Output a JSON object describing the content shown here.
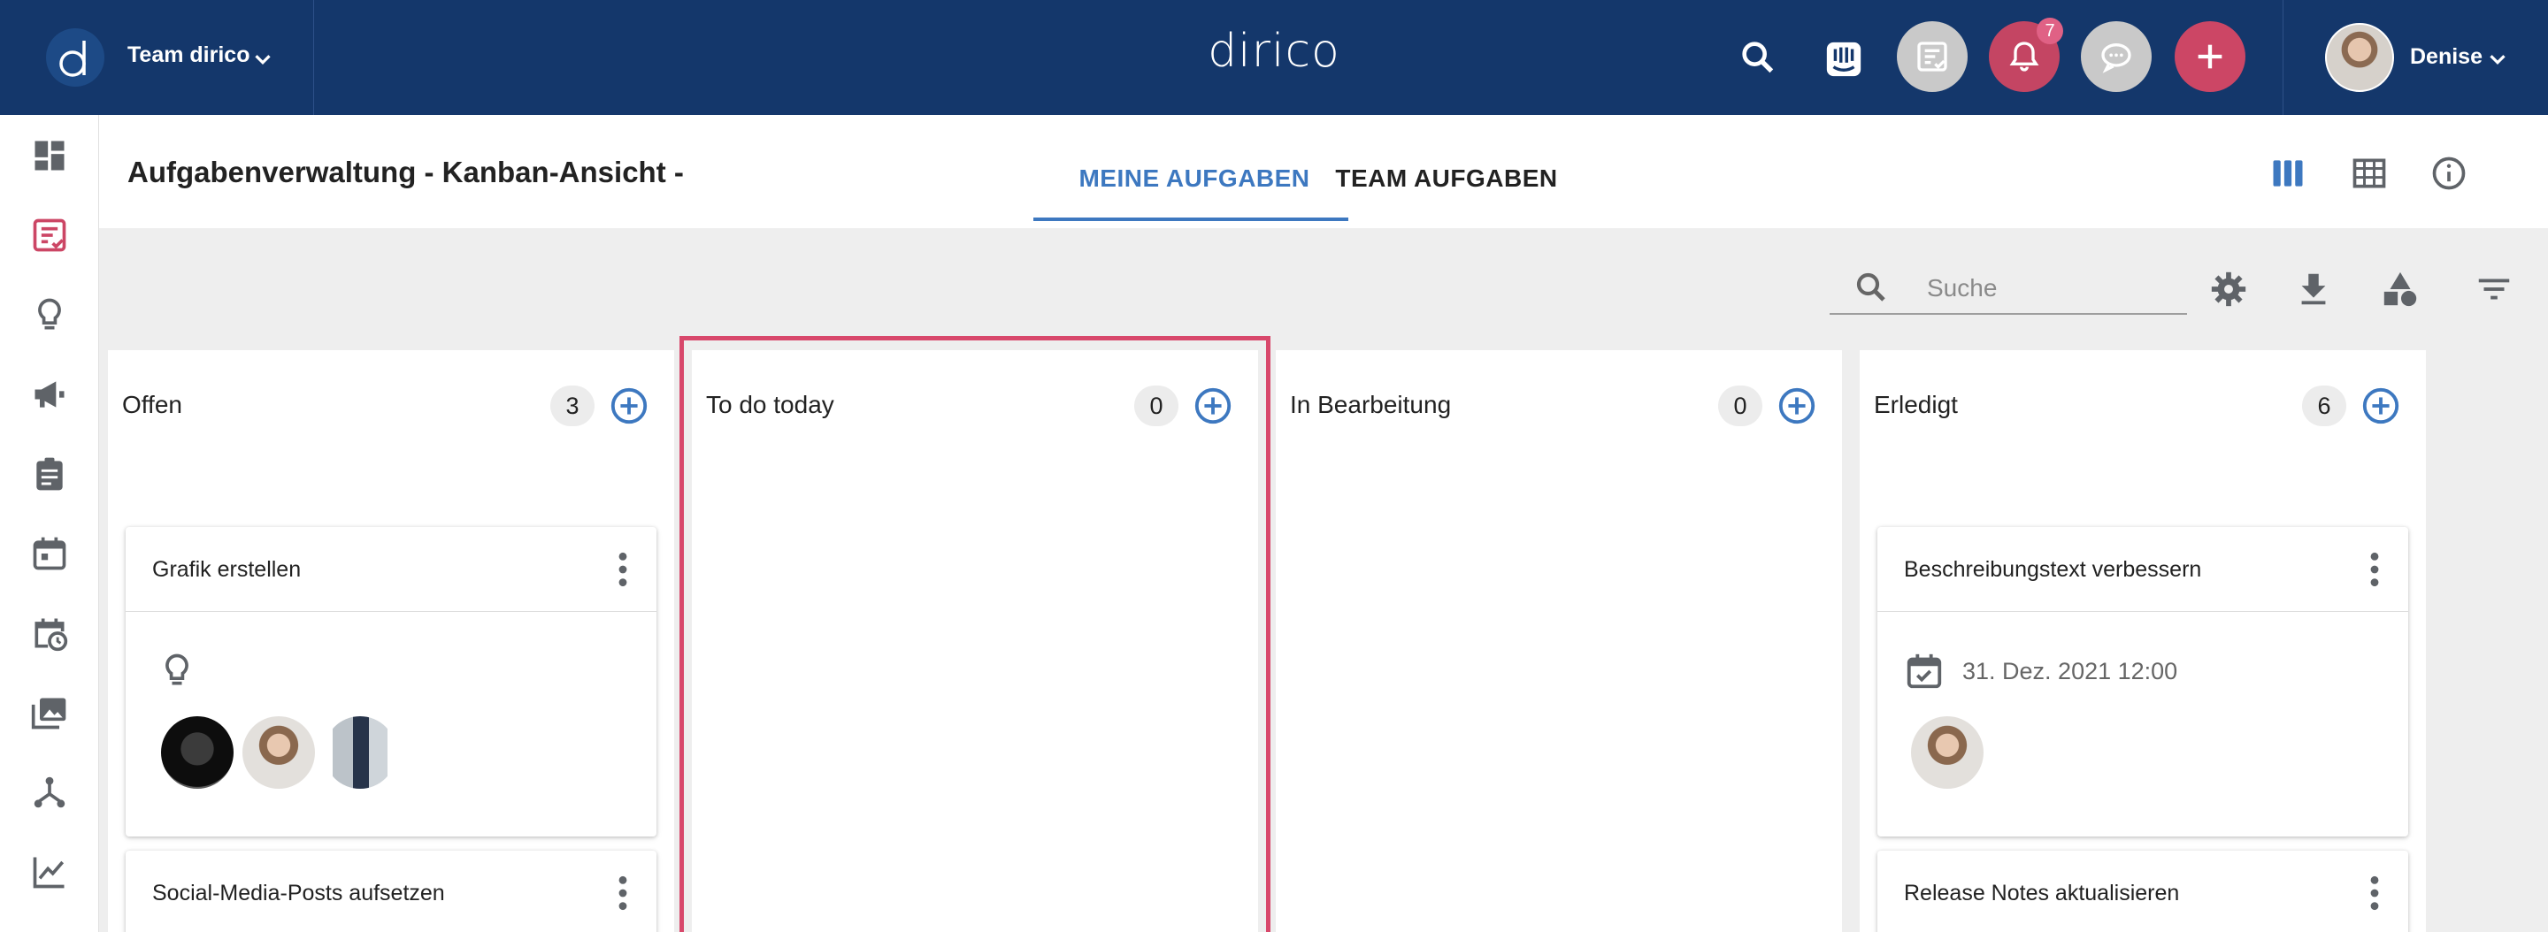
{
  "topbar": {
    "team_label": "Team dirico",
    "brand": "dirico",
    "notification_count": "7",
    "user_name": "Denise"
  },
  "header": {
    "title": "Aufgabenverwaltung - Kanban-Ansicht -",
    "tabs": [
      {
        "label": "MEINE AUFGABEN",
        "active": true
      },
      {
        "label": "TEAM AUFGABEN",
        "active": false
      }
    ]
  },
  "toolbar": {
    "search_placeholder": "Suche"
  },
  "columns": [
    {
      "title": "Offen",
      "count": "3",
      "cards": [
        {
          "title": "Grafik erstellen",
          "icon": "lightbulb-icon",
          "avatars": [
            "darth-vader",
            "woman",
            "man"
          ]
        },
        {
          "title": "Social-Media-Posts aufsetzen"
        }
      ]
    },
    {
      "title": "To do today",
      "count": "0",
      "highlighted": true,
      "cards": []
    },
    {
      "title": "In Bearbeitung",
      "count": "0",
      "cards": []
    },
    {
      "title": "Erledigt",
      "count": "6",
      "cards": [
        {
          "title": "Beschreibungstext verbessern",
          "due": "31. Dez. 2021 12:00",
          "avatars": [
            "woman"
          ]
        },
        {
          "title": "Release Notes aktualisieren"
        }
      ]
    }
  ],
  "colors": {
    "topbar": "#14376b",
    "accent_blue": "#3d78c0",
    "accent_red": "#cc4665",
    "highlight_border": "#d8486b"
  }
}
